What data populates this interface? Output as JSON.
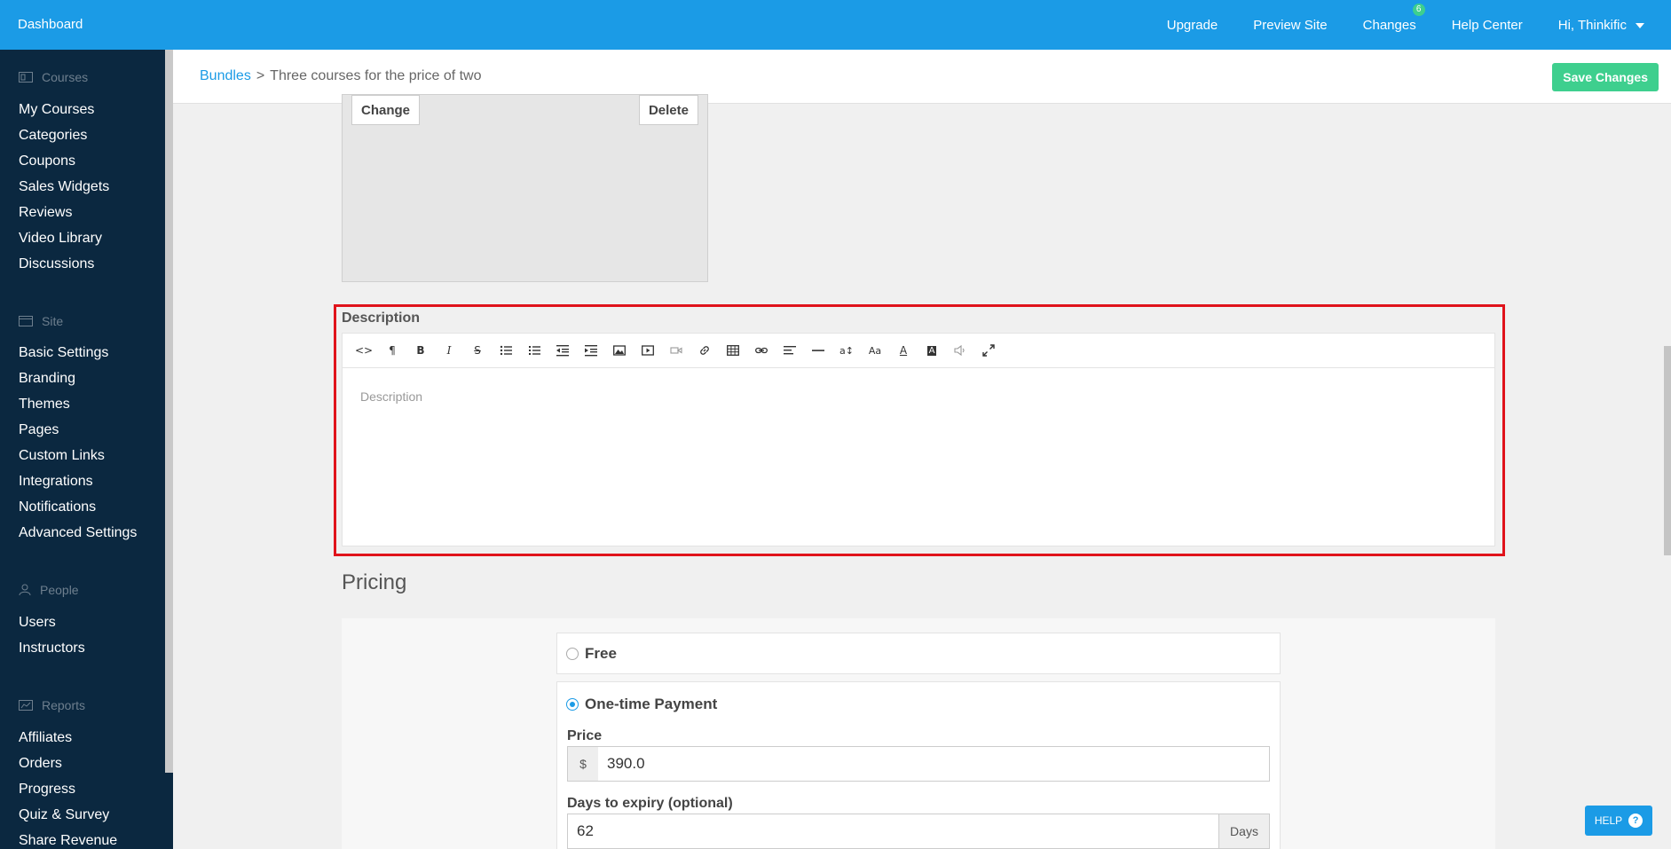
{
  "topbar": {
    "brand": "Dashboard",
    "nav": [
      "Upgrade",
      "Preview Site",
      "Changes",
      "Help Center"
    ],
    "changes_badge": "6",
    "user": "Hi, Thinkific"
  },
  "sidebar": {
    "sections": [
      {
        "title": "Courses",
        "icon": "courses-icon",
        "items": [
          "My Courses",
          "Categories",
          "Coupons",
          "Sales Widgets",
          "Reviews",
          "Video Library",
          "Discussions"
        ]
      },
      {
        "title": "Site",
        "icon": "site-icon",
        "items": [
          "Basic Settings",
          "Branding",
          "Themes",
          "Pages",
          "Custom Links",
          "Integrations",
          "Notifications",
          "Advanced Settings"
        ]
      },
      {
        "title": "People",
        "icon": "people-icon",
        "items": [
          "Users",
          "Instructors"
        ]
      },
      {
        "title": "Reports",
        "icon": "reports-icon",
        "items": [
          "Affiliates",
          "Orders",
          "Progress",
          "Quiz & Survey",
          "Share Revenue"
        ]
      }
    ]
  },
  "breadcrumb": {
    "root": "Bundles",
    "separator": ">",
    "current": "Three courses for the price of two"
  },
  "header": {
    "save_label": "Save Changes"
  },
  "image": {
    "change_label": "Change",
    "delete_label": "Delete"
  },
  "description": {
    "label": "Description",
    "placeholder": "Description",
    "toolbar": [
      "code-view",
      "paragraph-format",
      "bold",
      "italic",
      "strikethrough",
      "unordered-list",
      "ordered-list",
      "outdent",
      "indent",
      "insert-image",
      "insert-video",
      "insert-media",
      "insert-link",
      "insert-table",
      "link",
      "align",
      "horizontal-line",
      "line-height",
      "font-size",
      "font-color",
      "background-color",
      "audio",
      "fullscreen"
    ]
  },
  "pricing": {
    "title": "Pricing",
    "free_label": "Free",
    "one_time_label": "One-time Payment",
    "price_label": "Price",
    "currency": "$",
    "price_value": "390.0",
    "expiry_label": "Days to expiry (optional)",
    "expiry_value": "62",
    "expiry_unit": "Days",
    "selected": "one-time"
  },
  "help": {
    "label": "HELP",
    "glyph": "?"
  },
  "colors": {
    "topbar": "#1b9be6",
    "sidebar": "#0b2840",
    "save": "#3ecf8e",
    "highlight": "#e0131b"
  }
}
